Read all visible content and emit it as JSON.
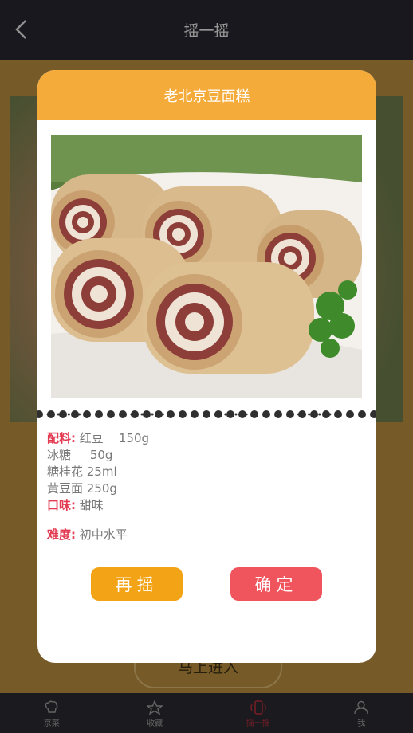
{
  "nav": {
    "title": "摇一摇"
  },
  "background": {
    "button_label": "马上进入"
  },
  "tabbar": {
    "items": [
      {
        "label": "京菜",
        "icon": "chef-icon"
      },
      {
        "label": "收藏",
        "icon": "star-icon"
      },
      {
        "label": "摇一摇",
        "icon": "shake-icon",
        "active": true
      },
      {
        "label": "我",
        "icon": "user-icon"
      }
    ]
  },
  "dialog": {
    "title": "老北京豆面糕",
    "ingredients_label": "配料:",
    "ingredients": [
      "红豆    150g",
      "冰糖     50g",
      "糖桂花 25ml",
      "黄豆面 250g"
    ],
    "taste_label": "口味:",
    "taste": "甜味",
    "difficulty_label": "难度:",
    "difficulty": "初中水平",
    "again_label": "再摇",
    "ok_label": "确定"
  },
  "colors": {
    "header": "#f4ab3a",
    "label": "#e23b52",
    "again": "#f3a316",
    "ok": "#f0545c"
  }
}
